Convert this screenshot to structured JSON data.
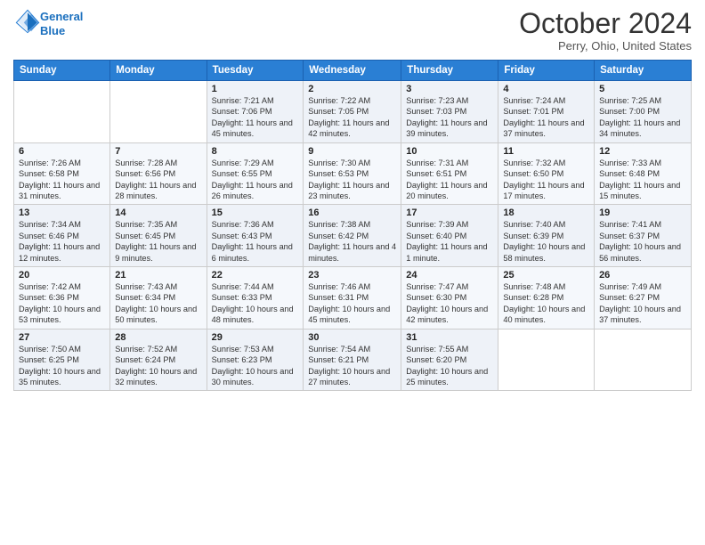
{
  "header": {
    "logo_line1": "General",
    "logo_line2": "Blue",
    "month_title": "October 2024",
    "location": "Perry, Ohio, United States"
  },
  "days_of_week": [
    "Sunday",
    "Monday",
    "Tuesday",
    "Wednesday",
    "Thursday",
    "Friday",
    "Saturday"
  ],
  "weeks": [
    [
      {
        "day": "",
        "sunrise": "",
        "sunset": "",
        "daylight": ""
      },
      {
        "day": "",
        "sunrise": "",
        "sunset": "",
        "daylight": ""
      },
      {
        "day": "1",
        "sunrise": "Sunrise: 7:21 AM",
        "sunset": "Sunset: 7:06 PM",
        "daylight": "Daylight: 11 hours and 45 minutes."
      },
      {
        "day": "2",
        "sunrise": "Sunrise: 7:22 AM",
        "sunset": "Sunset: 7:05 PM",
        "daylight": "Daylight: 11 hours and 42 minutes."
      },
      {
        "day": "3",
        "sunrise": "Sunrise: 7:23 AM",
        "sunset": "Sunset: 7:03 PM",
        "daylight": "Daylight: 11 hours and 39 minutes."
      },
      {
        "day": "4",
        "sunrise": "Sunrise: 7:24 AM",
        "sunset": "Sunset: 7:01 PM",
        "daylight": "Daylight: 11 hours and 37 minutes."
      },
      {
        "day": "5",
        "sunrise": "Sunrise: 7:25 AM",
        "sunset": "Sunset: 7:00 PM",
        "daylight": "Daylight: 11 hours and 34 minutes."
      }
    ],
    [
      {
        "day": "6",
        "sunrise": "Sunrise: 7:26 AM",
        "sunset": "Sunset: 6:58 PM",
        "daylight": "Daylight: 11 hours and 31 minutes."
      },
      {
        "day": "7",
        "sunrise": "Sunrise: 7:28 AM",
        "sunset": "Sunset: 6:56 PM",
        "daylight": "Daylight: 11 hours and 28 minutes."
      },
      {
        "day": "8",
        "sunrise": "Sunrise: 7:29 AM",
        "sunset": "Sunset: 6:55 PM",
        "daylight": "Daylight: 11 hours and 26 minutes."
      },
      {
        "day": "9",
        "sunrise": "Sunrise: 7:30 AM",
        "sunset": "Sunset: 6:53 PM",
        "daylight": "Daylight: 11 hours and 23 minutes."
      },
      {
        "day": "10",
        "sunrise": "Sunrise: 7:31 AM",
        "sunset": "Sunset: 6:51 PM",
        "daylight": "Daylight: 11 hours and 20 minutes."
      },
      {
        "day": "11",
        "sunrise": "Sunrise: 7:32 AM",
        "sunset": "Sunset: 6:50 PM",
        "daylight": "Daylight: 11 hours and 17 minutes."
      },
      {
        "day": "12",
        "sunrise": "Sunrise: 7:33 AM",
        "sunset": "Sunset: 6:48 PM",
        "daylight": "Daylight: 11 hours and 15 minutes."
      }
    ],
    [
      {
        "day": "13",
        "sunrise": "Sunrise: 7:34 AM",
        "sunset": "Sunset: 6:46 PM",
        "daylight": "Daylight: 11 hours and 12 minutes."
      },
      {
        "day": "14",
        "sunrise": "Sunrise: 7:35 AM",
        "sunset": "Sunset: 6:45 PM",
        "daylight": "Daylight: 11 hours and 9 minutes."
      },
      {
        "day": "15",
        "sunrise": "Sunrise: 7:36 AM",
        "sunset": "Sunset: 6:43 PM",
        "daylight": "Daylight: 11 hours and 6 minutes."
      },
      {
        "day": "16",
        "sunrise": "Sunrise: 7:38 AM",
        "sunset": "Sunset: 6:42 PM",
        "daylight": "Daylight: 11 hours and 4 minutes."
      },
      {
        "day": "17",
        "sunrise": "Sunrise: 7:39 AM",
        "sunset": "Sunset: 6:40 PM",
        "daylight": "Daylight: 11 hours and 1 minute."
      },
      {
        "day": "18",
        "sunrise": "Sunrise: 7:40 AM",
        "sunset": "Sunset: 6:39 PM",
        "daylight": "Daylight: 10 hours and 58 minutes."
      },
      {
        "day": "19",
        "sunrise": "Sunrise: 7:41 AM",
        "sunset": "Sunset: 6:37 PM",
        "daylight": "Daylight: 10 hours and 56 minutes."
      }
    ],
    [
      {
        "day": "20",
        "sunrise": "Sunrise: 7:42 AM",
        "sunset": "Sunset: 6:36 PM",
        "daylight": "Daylight: 10 hours and 53 minutes."
      },
      {
        "day": "21",
        "sunrise": "Sunrise: 7:43 AM",
        "sunset": "Sunset: 6:34 PM",
        "daylight": "Daylight: 10 hours and 50 minutes."
      },
      {
        "day": "22",
        "sunrise": "Sunrise: 7:44 AM",
        "sunset": "Sunset: 6:33 PM",
        "daylight": "Daylight: 10 hours and 48 minutes."
      },
      {
        "day": "23",
        "sunrise": "Sunrise: 7:46 AM",
        "sunset": "Sunset: 6:31 PM",
        "daylight": "Daylight: 10 hours and 45 minutes."
      },
      {
        "day": "24",
        "sunrise": "Sunrise: 7:47 AM",
        "sunset": "Sunset: 6:30 PM",
        "daylight": "Daylight: 10 hours and 42 minutes."
      },
      {
        "day": "25",
        "sunrise": "Sunrise: 7:48 AM",
        "sunset": "Sunset: 6:28 PM",
        "daylight": "Daylight: 10 hours and 40 minutes."
      },
      {
        "day": "26",
        "sunrise": "Sunrise: 7:49 AM",
        "sunset": "Sunset: 6:27 PM",
        "daylight": "Daylight: 10 hours and 37 minutes."
      }
    ],
    [
      {
        "day": "27",
        "sunrise": "Sunrise: 7:50 AM",
        "sunset": "Sunset: 6:25 PM",
        "daylight": "Daylight: 10 hours and 35 minutes."
      },
      {
        "day": "28",
        "sunrise": "Sunrise: 7:52 AM",
        "sunset": "Sunset: 6:24 PM",
        "daylight": "Daylight: 10 hours and 32 minutes."
      },
      {
        "day": "29",
        "sunrise": "Sunrise: 7:53 AM",
        "sunset": "Sunset: 6:23 PM",
        "daylight": "Daylight: 10 hours and 30 minutes."
      },
      {
        "day": "30",
        "sunrise": "Sunrise: 7:54 AM",
        "sunset": "Sunset: 6:21 PM",
        "daylight": "Daylight: 10 hours and 27 minutes."
      },
      {
        "day": "31",
        "sunrise": "Sunrise: 7:55 AM",
        "sunset": "Sunset: 6:20 PM",
        "daylight": "Daylight: 10 hours and 25 minutes."
      },
      {
        "day": "",
        "sunrise": "",
        "sunset": "",
        "daylight": ""
      },
      {
        "day": "",
        "sunrise": "",
        "sunset": "",
        "daylight": ""
      }
    ]
  ]
}
